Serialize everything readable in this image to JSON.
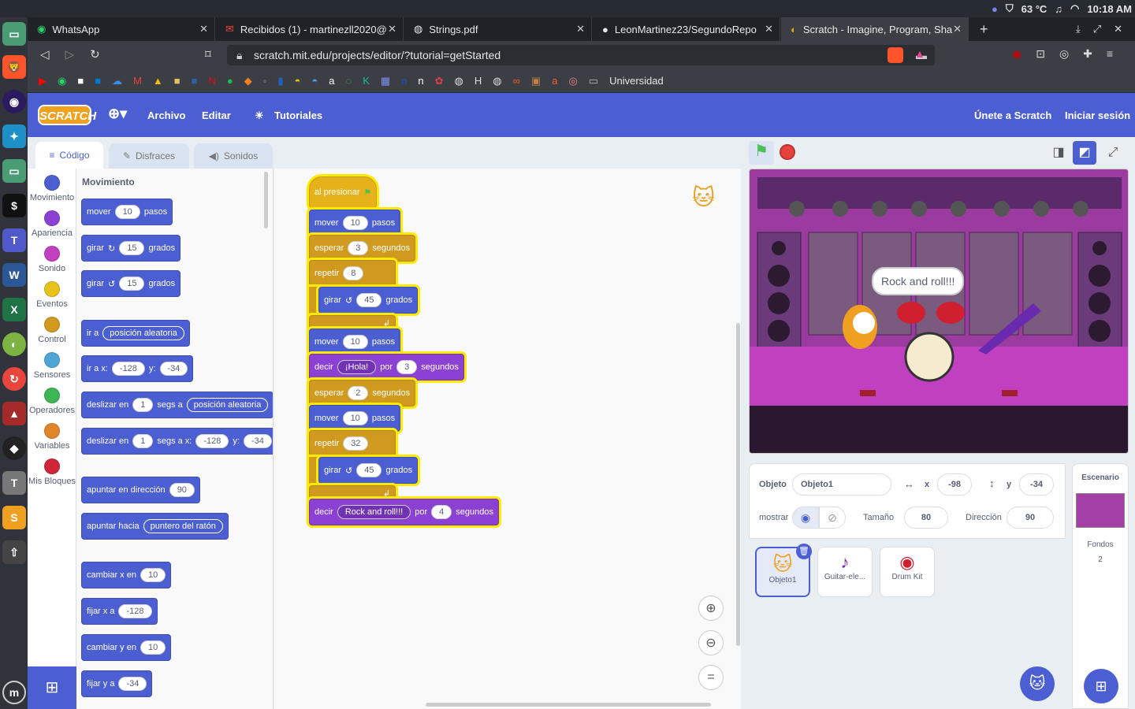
{
  "system": {
    "temperature": "63 °C",
    "clock": "10:18 AM"
  },
  "browser": {
    "tabs": [
      {
        "label": "WhatsApp"
      },
      {
        "label": "Recibidos (1) - martinezll2020@"
      },
      {
        "label": "Strings.pdf"
      },
      {
        "label": "LeonMartinez23/SegundoRepo"
      },
      {
        "label": "Scratch - Imagine, Program, Sha"
      }
    ],
    "url": "scratch.mit.edu/projects/editor/?tutorial=getStarted",
    "bookmark_folder": "Universidad",
    "bookmark_h": "H"
  },
  "menu": {
    "logo": "SCRATCH",
    "file": "Archivo",
    "edit": "Editar",
    "tutorials": "Tutoriales",
    "join": "Únete a Scratch",
    "signin": "Iniciar sesión"
  },
  "editor_tabs": {
    "code": "Código",
    "costumes": "Disfraces",
    "sounds": "Sonidos"
  },
  "categories": [
    {
      "label": "Movimiento",
      "color": "#4c5fd2"
    },
    {
      "label": "Apariencia",
      "color": "#8a41d4"
    },
    {
      "label": "Sonido",
      "color": "#c040c0"
    },
    {
      "label": "Eventos",
      "color": "#e6c21b"
    },
    {
      "label": "Control",
      "color": "#cf9a1d"
    },
    {
      "label": "Sensores",
      "color": "#4fa6d6"
    },
    {
      "label": "Operadores",
      "color": "#3eb556"
    },
    {
      "label": "Variables",
      "color": "#e0852a"
    },
    {
      "label": "Mis Bloques",
      "color": "#d0263a"
    }
  ],
  "palette": {
    "heading": "Movimiento",
    "move": {
      "a": "mover",
      "v": "10",
      "b": "pasos"
    },
    "turn_r": {
      "a": "girar",
      "v": "15",
      "b": "grados"
    },
    "turn_l": {
      "a": "girar",
      "v": "15",
      "b": "grados"
    },
    "goto": {
      "a": "ir a",
      "d": "posición aleatoria"
    },
    "gotoxy": {
      "a": "ir a x:",
      "x": "-128",
      "yl": "y:",
      "y": "-34"
    },
    "glide": {
      "a": "deslizar en",
      "v": "1",
      "b": "segs a",
      "d": "posición aleatoria"
    },
    "glidexy": {
      "a": "deslizar en",
      "v": "1",
      "b": "segs a x:",
      "x": "-128",
      "yl": "y:",
      "y": "-34"
    },
    "point": {
      "a": "apuntar en dirección",
      "v": "90"
    },
    "pointto": {
      "a": "apuntar hacia",
      "d": "puntero del ratón"
    },
    "changex": {
      "a": "cambiar x en",
      "v": "10"
    },
    "setx": {
      "a": "fijar x a",
      "v": "-128"
    },
    "changey": {
      "a": "cambiar y en",
      "v": "10"
    },
    "sety": {
      "a": "fijar y a",
      "v": "-34"
    }
  },
  "script": {
    "hat": "al presionar",
    "b1": {
      "a": "mover",
      "v": "10",
      "b": "pasos"
    },
    "b2": {
      "a": "esperar",
      "v": "3",
      "b": "segundos"
    },
    "b3": {
      "a": "repetir",
      "v": "8"
    },
    "b4": {
      "a": "girar",
      "v": "45",
      "b": "grados"
    },
    "b5": {
      "a": "mover",
      "v": "10",
      "b": "pasos"
    },
    "b6": {
      "a": "decir",
      "t": "¡Hola!",
      "p": "por",
      "v": "3",
      "b": "segundos"
    },
    "b7": {
      "a": "esperar",
      "v": "2",
      "b": "segundos"
    },
    "b8": {
      "a": "mover",
      "v": "10",
      "b": "pasos"
    },
    "b9": {
      "a": "repetir",
      "v": "32"
    },
    "b10": {
      "a": "girar",
      "v": "45",
      "b": "grados"
    },
    "b11": {
      "a": "decir",
      "t": "Rock and roll!!!",
      "p": "por",
      "v": "4",
      "b": "segundos"
    }
  },
  "stage": {
    "speech": "Rock and roll!!!"
  },
  "sprite_info": {
    "sprite_label": "Objeto",
    "sprite_name": "Objeto1",
    "x_label": "x",
    "x": "-98",
    "y_label": "y",
    "y": "-34",
    "show_label": "mostrar",
    "size_label": "Tamaño",
    "size": "80",
    "dir_label": "Dirección",
    "dir": "90"
  },
  "sprites": [
    {
      "name": "Objeto1"
    },
    {
      "name": "Guitar-ele..."
    },
    {
      "name": "Drum Kit"
    }
  ],
  "scene": {
    "title": "Escenario",
    "backdrops_label": "Fondos",
    "backdrops": "2"
  }
}
